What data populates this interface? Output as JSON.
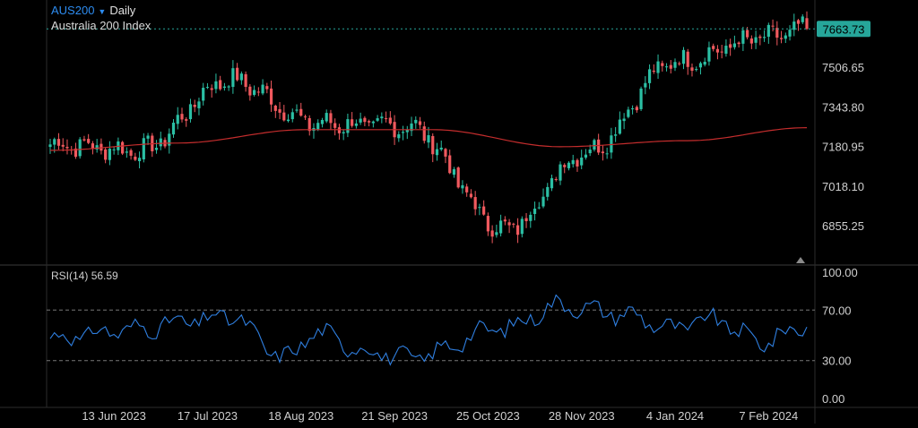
{
  "header": {
    "symbol": "AUS200",
    "timeframe": "Daily",
    "instrument_name": "Australia 200 Index",
    "rsi_label": "RSI(14)",
    "rsi_value": "56.59"
  },
  "colors": {
    "bull": "#2bbfa4",
    "bear": "#f0595e",
    "ma": "#c42d2d",
    "rsi": "#2f7fe0",
    "price_tag_bg": "#26a69a",
    "grid": "#2a2a2a",
    "last_price_line": "#26a69a"
  },
  "chart_data": [
    {
      "type": "candlestick",
      "title": "AUS200 Daily",
      "last_price": "7663.73",
      "y_ticks": [
        "7506.65",
        "7343.80",
        "7180.95",
        "7018.10",
        "6855.25"
      ],
      "ylim": [
        6730,
        7715
      ],
      "x_tick_labels": [
        "13 Jun 2023",
        "17 Jul 2023",
        "18 Aug 2023",
        "21 Sep 2023",
        "25 Oct 2023",
        "28 Nov 2023",
        "4 Jan 2024",
        "7 Feb 2024"
      ],
      "anchors_index": [
        0,
        21,
        42,
        63,
        84,
        107,
        126,
        147,
        168,
        178
      ],
      "anchors_close": [
        7190,
        7165,
        7455,
        7275,
        7265,
        6840,
        7160,
        7530,
        7625,
        7663.73
      ],
      "ma_series": [
        {
          "i": 0,
          "v": 7165
        },
        {
          "i": 30,
          "v": 7195
        },
        {
          "i": 60,
          "v": 7250
        },
        {
          "i": 90,
          "v": 7250
        },
        {
          "i": 120,
          "v": 7180
        },
        {
          "i": 150,
          "v": 7205
        },
        {
          "i": 178,
          "v": 7258
        }
      ],
      "ma_type": "moving-average"
    },
    {
      "type": "line",
      "title": "RSI(14)",
      "y_ticks": [
        "100.00",
        "70.00",
        "30.00",
        "0.00"
      ],
      "ylim": [
        0,
        100
      ],
      "reference_lines": [
        70,
        30
      ],
      "anchors_index": [
        0,
        21,
        30,
        42,
        55,
        63,
        74,
        84,
        107,
        120,
        135,
        147,
        155,
        168,
        175,
        178
      ],
      "anchors_value": [
        48,
        55,
        60,
        65,
        33,
        52,
        38,
        32,
        56,
        74,
        67,
        55,
        63,
        45,
        54,
        56.59
      ]
    }
  ]
}
